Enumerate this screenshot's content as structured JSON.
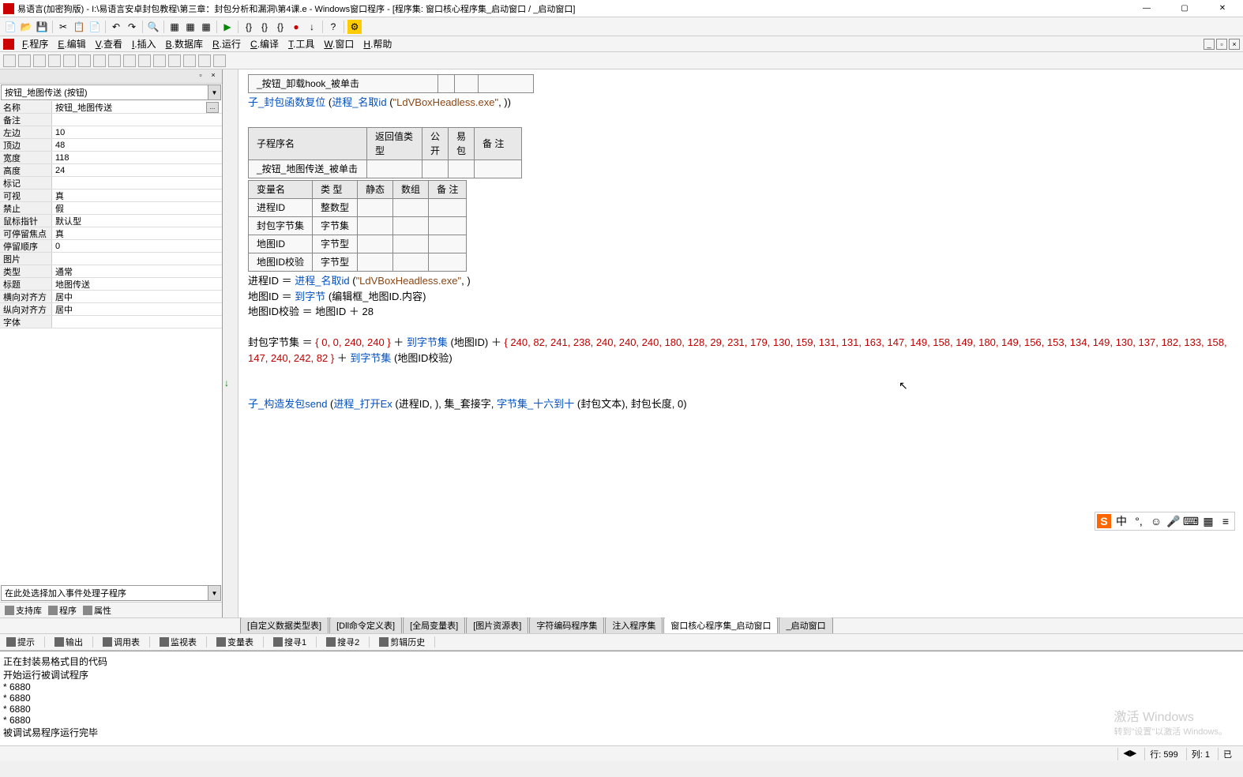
{
  "title": "易语言(加密狗版) - I:\\易语言安卓封包教程\\第三章：封包分析和漏洞\\第4课.e - Windows窗口程序 - [程序集: 窗口核心程序集_启动窗口 / _启动窗口]",
  "menus": [
    "F.程序",
    "E.编辑",
    "V.查看",
    "I.插入",
    "B.数据库",
    "R.运行",
    "C.编译",
    "T.工具",
    "W.窗口",
    "H.帮助"
  ],
  "combo_selected": "按钮_地图传送 (按钮)",
  "properties": [
    {
      "name": "名称",
      "value": "按钮_地图传送",
      "hasBtn": true
    },
    {
      "name": "备注",
      "value": ""
    },
    {
      "name": "左边",
      "value": "10"
    },
    {
      "name": "顶边",
      "value": "48"
    },
    {
      "name": "宽度",
      "value": "118"
    },
    {
      "name": "高度",
      "value": "24"
    },
    {
      "name": "标记",
      "value": ""
    },
    {
      "name": "可视",
      "value": "真"
    },
    {
      "name": "禁止",
      "value": "假"
    },
    {
      "name": "鼠标指针",
      "value": "默认型"
    },
    {
      "name": "可停留焦点",
      "value": "真"
    },
    {
      "name": "停留顺序",
      "value": "0"
    },
    {
      "name": "图片",
      "value": ""
    },
    {
      "name": "类型",
      "value": "通常"
    },
    {
      "name": "标题",
      "value": "地图传送"
    },
    {
      "name": "横向对齐方式",
      "value": "居中"
    },
    {
      "name": "纵向对齐方式",
      "value": "居中"
    },
    {
      "name": "字体",
      "value": ""
    }
  ],
  "bottom_combo": "在此处选择加入事件处理子程序",
  "left_tabs": [
    "支持库",
    "程序",
    "属性"
  ],
  "code_line1_a": "_按钮_卸载hook_被单击",
  "code_line2_func": "子_封包函数复位",
  "code_line2_call": "进程_名取id",
  "code_line2_str": "\"LdVBoxHeadless.exe\"",
  "table1_headers": [
    "子程序名",
    "返回值类型",
    "公开",
    "易包",
    "备 注"
  ],
  "table1_row1": "_按钮_地图传送_被单击",
  "table2_headers": [
    "变量名",
    "类 型",
    "静态",
    "数组",
    "备 注"
  ],
  "table2_rows": [
    [
      "进程ID",
      "整数型",
      "",
      "",
      ""
    ],
    [
      "封包字节集",
      "字节集",
      "",
      "",
      ""
    ],
    [
      "地图ID",
      "字节型",
      "",
      "",
      ""
    ],
    [
      "地图ID校验",
      "字节型",
      "",
      "",
      ""
    ]
  ],
  "code_assign1_l": "进程ID",
  "code_assign1_r": "进程_名取id",
  "code_assign1_str": "\"LdVBoxHeadless.exe\"",
  "code_assign2_l": "地图ID",
  "code_assign2_r": "到字节",
  "code_assign2_arg": "编辑框_地图ID.内容",
  "code_assign3_l": "地图ID校验",
  "code_assign3_r": "地图ID ＋ 28",
  "code_bytes_l": "封包字节集",
  "code_bytes_set1": "{ 0, 0, 240, 240 }",
  "code_bytes_fn": "到字节集",
  "code_bytes_arg1": "地图ID",
  "code_bytes_set2": "{ 240, 82, 241, 238, 240, 240, 240, 180, 128, 29, 231, 179, 130, 159, 131, 131, 163, 147, 149, 158, 149, 180, 149, 156, 153, 134, 149, 130, 137, 182, 133, 158, 147, 240, 242, 82 }",
  "code_bytes_arg2": "地图ID校验",
  "code_send_fn": "子_构造发包send",
  "code_send_a1": "进程_打开Ex",
  "code_send_a1arg": "进程ID",
  "code_send_a2": "集_套接字",
  "code_send_a3": "字节集_十六到十",
  "code_send_a3arg": "封包文本",
  "code_send_a4": "封包长度",
  "code_tabs": [
    "[自定义数据类型表]",
    "[Dll命令定义表]",
    "[全局变量表]",
    "[图片资源表]",
    "字符编码程序集",
    "注入程序集",
    "窗口核心程序集_启动窗口",
    "_启动窗口"
  ],
  "code_tabs_active": 6,
  "debug_tabs": [
    "提示",
    "输出",
    "调用表",
    "监视表",
    "变量表",
    "搜寻1",
    "搜寻2",
    "剪辑历史"
  ],
  "output_lines": [
    "正在封装易格式目的代码",
    "开始运行被调试程序",
    "* 6880",
    "* 6880",
    "* 6880",
    "* 6880",
    "被调试易程序运行完毕"
  ],
  "watermark": "激活 Windows",
  "watermark_sub": "转到\"设置\"以激活 Windows。",
  "status_row": "行: 599",
  "status_col": "列: 1",
  "status_mod": "已",
  "input_lang": "中"
}
